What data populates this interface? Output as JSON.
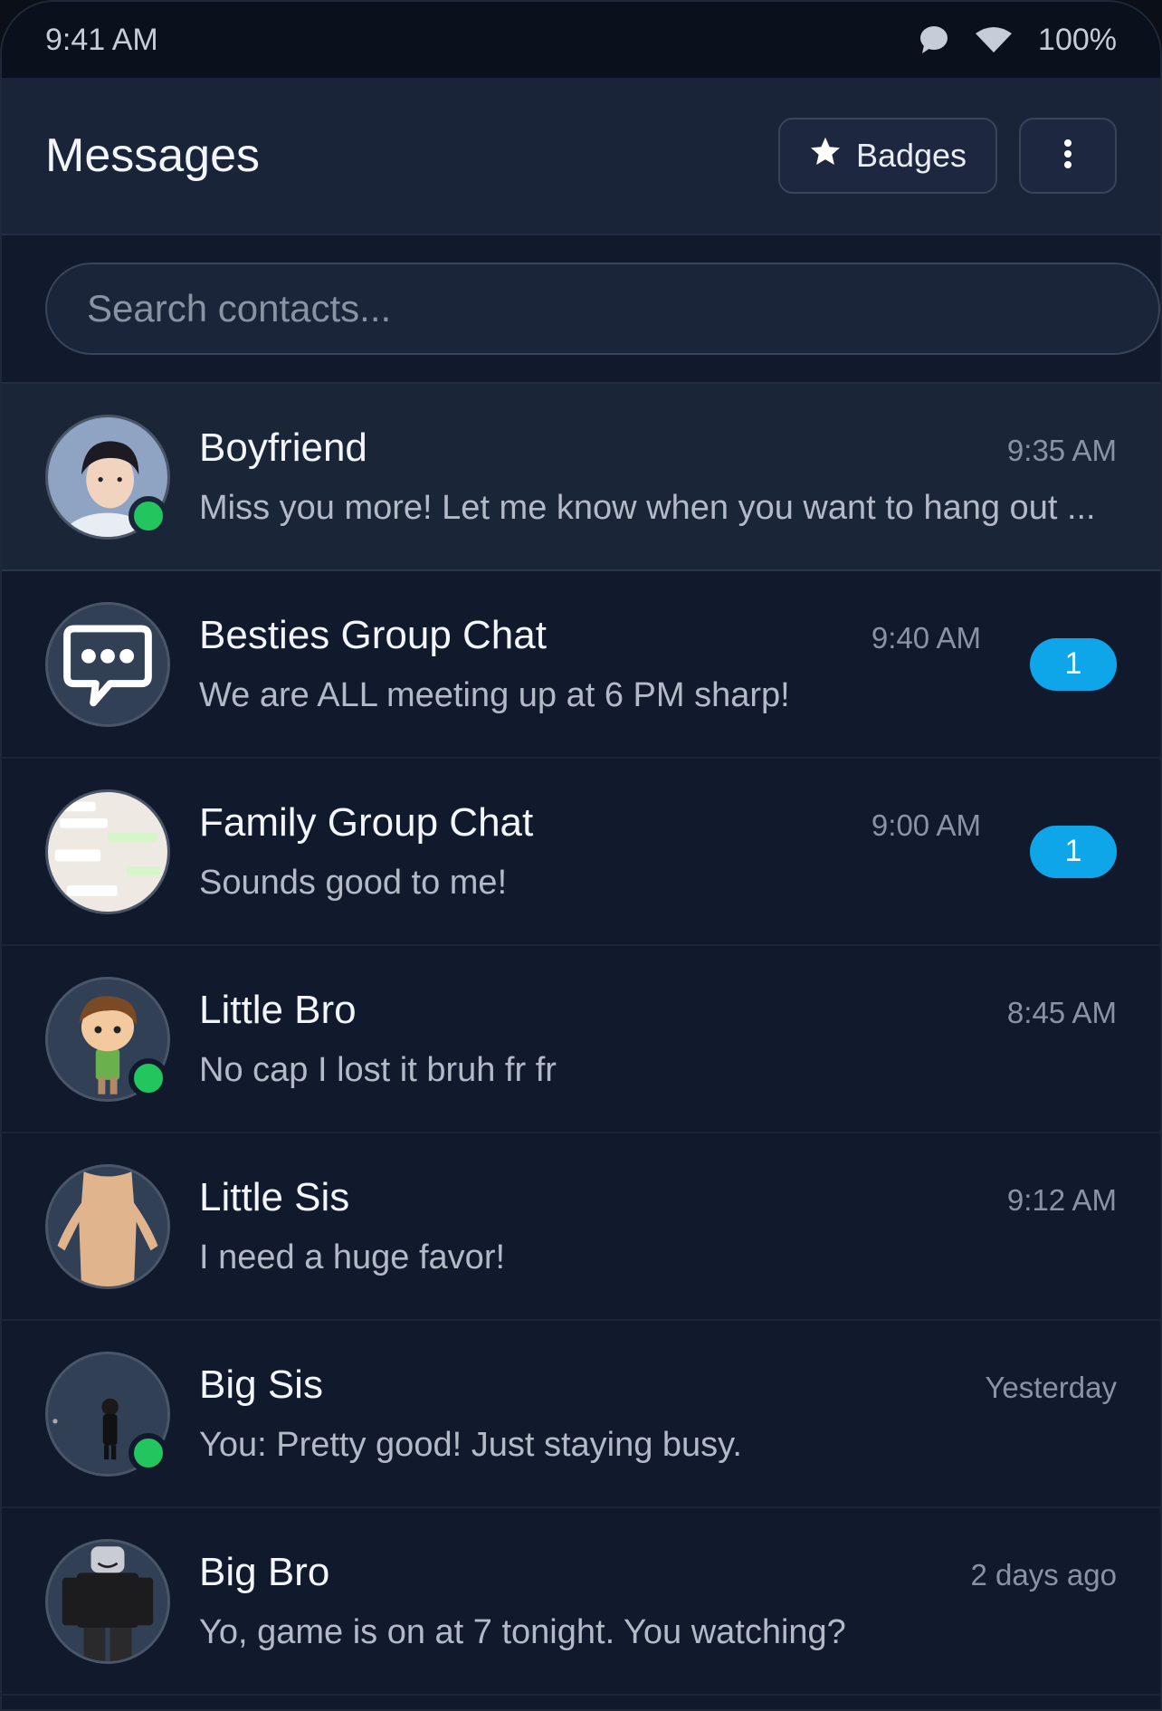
{
  "status_bar": {
    "time": "9:41 AM",
    "battery": "100%"
  },
  "header": {
    "title": "Messages",
    "badges_label": "Badges"
  },
  "search": {
    "placeholder": "Search contacts...",
    "value": ""
  },
  "conversations": [
    {
      "name": "Boyfriend",
      "time": "9:35 AM",
      "preview": "Miss you more! Let me know when you want to hang out ...",
      "online": true,
      "unread": ""
    },
    {
      "name": "Besties Group Chat",
      "time": "9:40 AM",
      "preview": "We are ALL meeting up at 6 PM sharp!",
      "online": false,
      "unread": "1"
    },
    {
      "name": "Family Group Chat",
      "time": "9:00 AM",
      "preview": "Sounds good to me!",
      "online": false,
      "unread": "1"
    },
    {
      "name": "Little Bro",
      "time": "8:45 AM",
      "preview": "No cap I lost it bruh fr fr",
      "online": true,
      "unread": ""
    },
    {
      "name": "Little Sis",
      "time": "9:12 AM",
      "preview": "I need a huge favor!",
      "online": false,
      "unread": ""
    },
    {
      "name": "Big Sis",
      "time": "Yesterday",
      "preview": "You: Pretty good! Just staying busy.",
      "online": true,
      "unread": ""
    },
    {
      "name": "Big Bro",
      "time": "2 days ago",
      "preview": "Yo, game is on at 7 tonight. You watching?",
      "online": false,
      "unread": ""
    }
  ],
  "colors": {
    "online": "#22c55e",
    "unread_badge": "#0ea5e9",
    "header_bg": "#1a2439",
    "list_bg": "#111a2c"
  }
}
